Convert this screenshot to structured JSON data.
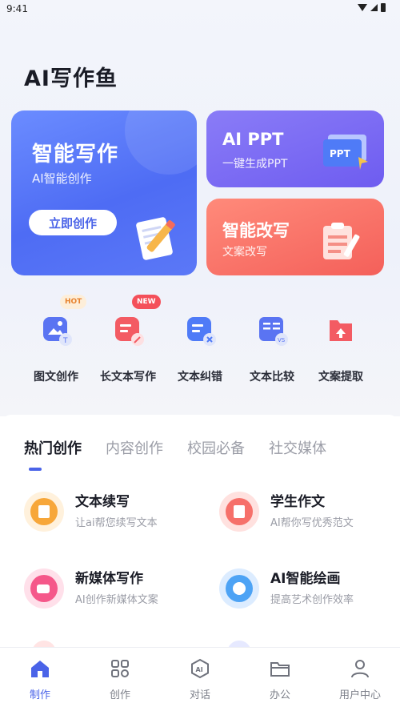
{
  "status_bar": {
    "time": "9:41"
  },
  "app_title": "AI写作鱼",
  "cards": {
    "write": {
      "title": "智能写作",
      "subtitle": "AI智能创作",
      "button": "立即创作"
    },
    "ppt": {
      "title": "AI PPT",
      "subtitle": "一键生成PPT",
      "illus_text": "PPT"
    },
    "rewrite": {
      "title": "智能改写",
      "subtitle": "文案改写"
    }
  },
  "tools": [
    {
      "label": "图文创作",
      "icon": "image-text-icon",
      "badge": "HOT"
    },
    {
      "label": "长文本写作",
      "icon": "long-text-icon",
      "badge": "NEW"
    },
    {
      "label": "文本纠错",
      "icon": "text-correct-icon",
      "badge": ""
    },
    {
      "label": "文本比较",
      "icon": "text-compare-icon",
      "badge": ""
    },
    {
      "label": "文案提取",
      "icon": "extract-icon",
      "badge": ""
    }
  ],
  "tabs": [
    "热门创作",
    "内容创作",
    "校园必备",
    "社交媒体"
  ],
  "features": [
    {
      "title": "文本续写",
      "subtitle": "让ai帮您续写文本",
      "icon": "continue-write-icon"
    },
    {
      "title": "学生作文",
      "subtitle": "AI帮你写优秀范文",
      "icon": "essay-icon"
    },
    {
      "title": "新媒体写作",
      "subtitle": "AI创作新媒体文案",
      "icon": "media-camera-icon"
    },
    {
      "title": "AI智能绘画",
      "subtitle": "提高艺术创作效率",
      "icon": "palette-icon"
    }
  ],
  "bottom_nav": [
    {
      "label": "制作",
      "icon": "home-icon"
    },
    {
      "label": "创作",
      "icon": "grid-icon"
    },
    {
      "label": "对话",
      "icon": "ai-chat-icon"
    },
    {
      "label": "办公",
      "icon": "folder-icon"
    },
    {
      "label": "用户中心",
      "icon": "user-icon"
    }
  ],
  "colors": {
    "accent": "#4a63e8",
    "write_card": "#5b78f7",
    "ppt_card": "#7a68f3",
    "rewrite_card": "#f76d63",
    "hot_badge": "#e7832f",
    "new_badge": "#f4505a"
  }
}
